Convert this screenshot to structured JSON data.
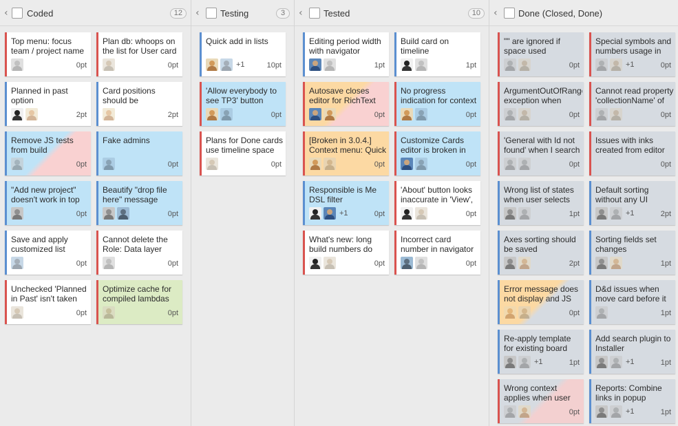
{
  "columns": [
    {
      "title": "Coded",
      "count": "12"
    },
    {
      "title": "Testing",
      "count": "3"
    },
    {
      "title": "Tested",
      "count": "10"
    },
    {
      "title": "Done (Closed, Done)",
      "count": ""
    }
  ],
  "cards": {
    "coded": [
      {
        "title": "Top menu: focus team / project name",
        "points": "0pt"
      },
      {
        "title": "Plan db: whoops on the list for User card",
        "points": "0pt"
      },
      {
        "title": "Planned in past option",
        "points": "2pt"
      },
      {
        "title": "Card positions should be",
        "points": "2pt"
      },
      {
        "title": "Remove JS tests from build",
        "points": "0pt"
      },
      {
        "title": "Fake admins",
        "points": "0pt"
      },
      {
        "title": "\"Add new project\" doesn't work in top",
        "points": "0pt"
      },
      {
        "title": "Beautify \"drop file here\" message",
        "points": "0pt"
      },
      {
        "title": "Save and apply customized list",
        "points": "0pt"
      },
      {
        "title": "Cannot delete the Role: Data layer",
        "points": "0pt"
      },
      {
        "title": "Unchecked 'Planned in Past' isn't taken",
        "points": "0pt"
      },
      {
        "title": "Optimize cache for compiled lambdas",
        "points": "0pt"
      }
    ],
    "testing": [
      {
        "title": "Quick add in lists",
        "points": "10pt",
        "extra": "+1"
      },
      {
        "title": "'Allow everybody to see TP3' button",
        "points": "0pt"
      },
      {
        "title": "Plans for Done cards use timeline space",
        "points": "0pt"
      }
    ],
    "tested": [
      {
        "title": "Editing period width with navigator",
        "points": "1pt"
      },
      {
        "title": "Build card on timeline",
        "points": "1pt"
      },
      {
        "title": "Autosave closes editor for RichText",
        "points": "0pt"
      },
      {
        "title": "No progress indication for context",
        "points": "0pt"
      },
      {
        "title": "[Broken in 3.0.4.] Context menu: Quick",
        "points": "0pt"
      },
      {
        "title": "Customize Cards editor is broken in",
        "points": "0pt"
      },
      {
        "title": "Responsible is Me DSL filter",
        "points": "0pt",
        "extra": "+1"
      },
      {
        "title": "'About' button looks inaccurate in 'View',",
        "points": "0pt"
      },
      {
        "title": "What's new: long build numbers do",
        "points": "0pt"
      },
      {
        "title": "Incorrect card number in navigator",
        "points": "0pt"
      }
    ],
    "done": [
      {
        "title": "\"\" are ignored if space used immediately",
        "points": "0pt"
      },
      {
        "title": "Special symbols and numbers usage in",
        "points": "0pt",
        "extra": "+1"
      },
      {
        "title": "ArgumentOutOfRange exception when",
        "points": "0pt"
      },
      {
        "title": "Cannot read property 'collectionName' of",
        "points": "0pt"
      },
      {
        "title": "'General with Id not found' when I search",
        "points": "0pt"
      },
      {
        "title": "Issues with inks created from editor",
        "points": "0pt"
      },
      {
        "title": "Wrong list of states when user selects",
        "points": "1pt"
      },
      {
        "title": "Default sorting without any UI",
        "points": "2pt",
        "extra": "+1"
      },
      {
        "title": "Axes sorting should be saved",
        "points": "2pt"
      },
      {
        "title": "Sorting fields set changes",
        "points": "1pt"
      },
      {
        "title": "Error message does not display and JS",
        "points": "0pt"
      },
      {
        "title": "D&d issues when move card before it",
        "points": "1pt"
      },
      {
        "title": "Re-apply template for existing board",
        "points": "1pt",
        "extra": "+1"
      },
      {
        "title": "Add search plugin to Installer",
        "points": "1pt",
        "extra": "+1"
      },
      {
        "title": "Wrong context applies when user",
        "points": "0pt"
      },
      {
        "title": "Reports: Combine links in popup",
        "points": "1pt",
        "extra": "+1"
      }
    ]
  }
}
